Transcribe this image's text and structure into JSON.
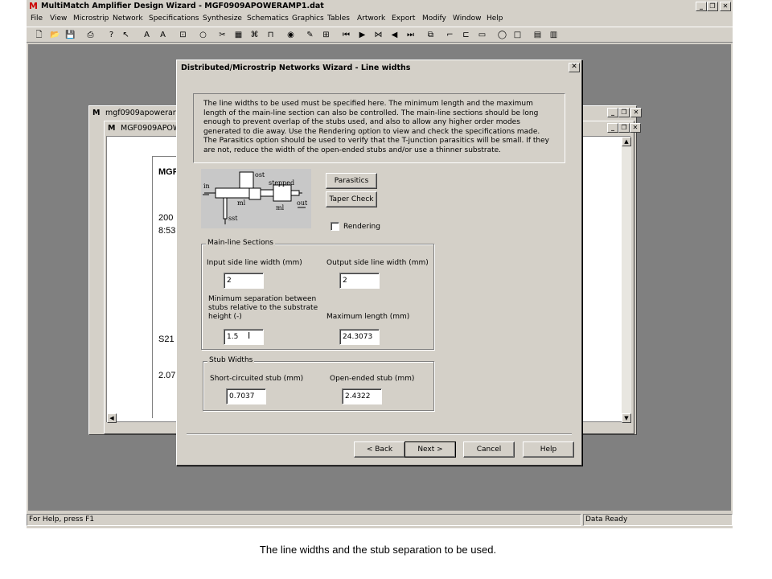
{
  "app": {
    "title": "MultiMatch Amplifier Design Wizard - MGF0909APOWERAMP1.dat",
    "logo": "M",
    "menu": [
      "File",
      "View",
      "Microstrip",
      "Network",
      "Specifications",
      "Synthesize",
      "Schematics",
      "Graphics",
      "Tables",
      "Artwork",
      "Export",
      "Modify",
      "Window",
      "Help"
    ],
    "status_left": "For Help, press F1",
    "status_right": "Data Ready"
  },
  "child_window_1": {
    "title": "mgf0909apowerar"
  },
  "child_window_2": {
    "title": "MGF0909APOW",
    "doc_lines": [
      "MGF",
      "200",
      "8:53",
      "S21",
      "2.07"
    ]
  },
  "dialog": {
    "title": "Distributed/Microstrip Networks Wizard - Line widths",
    "close_glyph": "✕",
    "description": "The line widths to be used must be specified here. The minimum length and the maximum length of the main-line section can also be controlled. The main-line sections should be long enough to prevent overlap of the stubs used, and also to allow any higher order modes generated to die away. Use the Rendering option to view and check the specifications made. The Parasitics option should be used to verify that the T-junction parasitics will be  small.  If they are not, reduce the width of the open-ended stubs and/or use a thinner substrate.",
    "diagram_labels": {
      "in": "in",
      "ost": "ost",
      "stepped": "stepped",
      "ml_1": "ml",
      "ml_2": "ml",
      "out": "out",
      "sst": "sst"
    },
    "parasitics_label": "Parasitics",
    "taper_check_label": "Taper Check",
    "rendering_label": "Rendering",
    "rendering_checked": false,
    "main_line": {
      "title": "Main-line Sections",
      "input_label": "Input side line width (mm)",
      "input_value": "2",
      "output_label": "Output side line width (mm)",
      "output_value": "2",
      "min_sep_label_1": "Minimum separation between",
      "min_sep_label_2": "stubs relative to the substrate",
      "min_sep_label_3": "height (-)",
      "min_sep_value": "1.5",
      "max_len_label": "Maximum length (mm)",
      "max_len_value": "24.3073"
    },
    "stub_widths": {
      "title": "Stub Widths",
      "short_label": "Short-circuited stub (mm)",
      "short_value": "0.7037",
      "open_label": "Open-ended stub (mm)",
      "open_value": "2.4322"
    },
    "buttons": {
      "back": "< Back",
      "next": "Next >",
      "cancel": "Cancel",
      "help": "Help"
    }
  },
  "caption": "The line widths and the stub separation to be used."
}
